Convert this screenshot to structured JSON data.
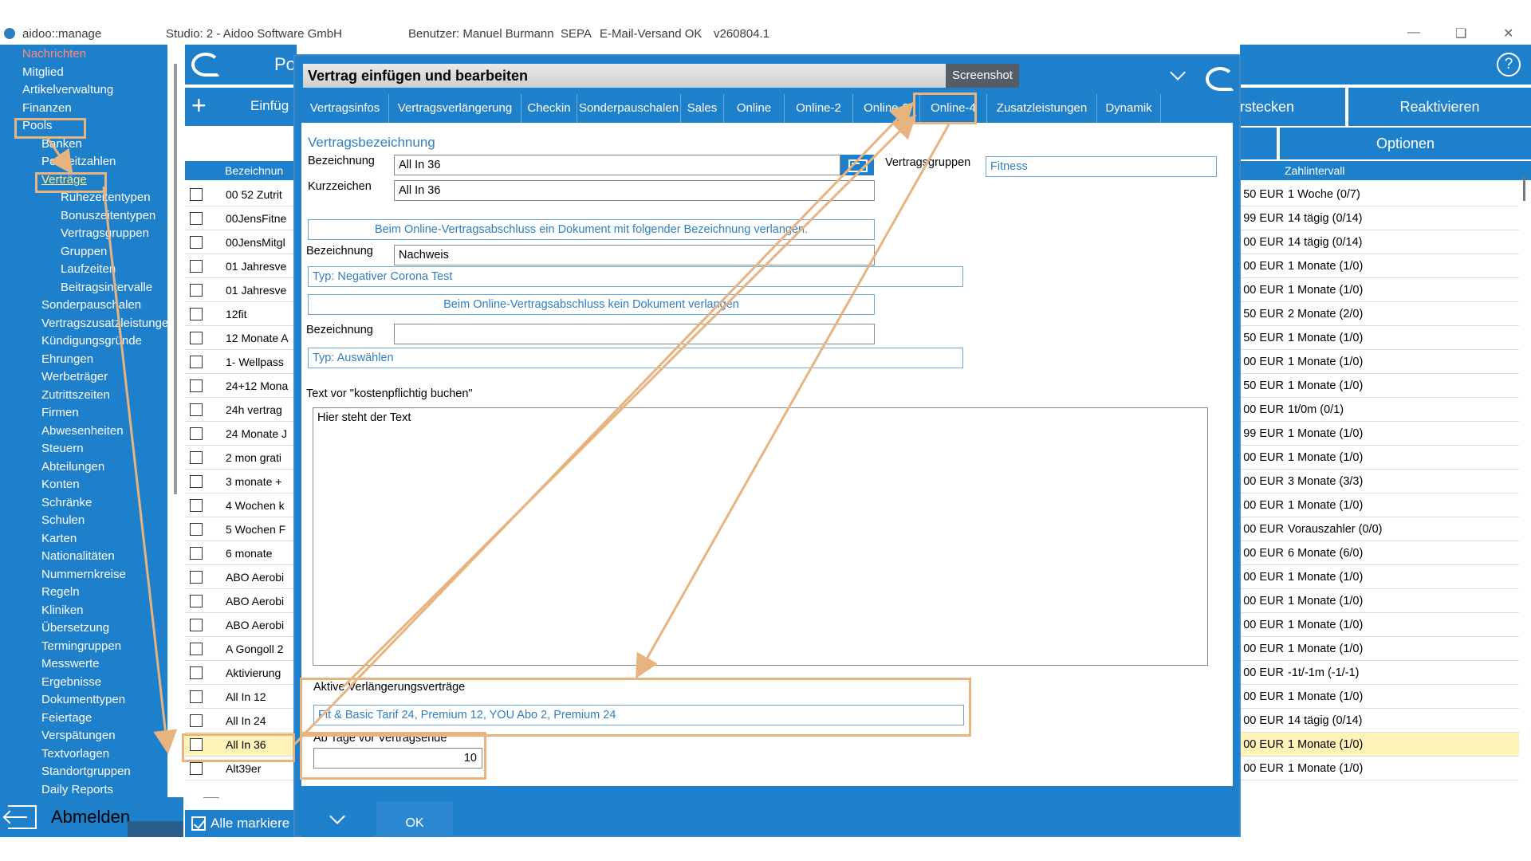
{
  "titlebar": {
    "app": "aidoo::manage",
    "studio": "Studio: 2 - Aidoo Software GmbH",
    "user": "Benutzer: Manuel Burmann",
    "sepa": "SEPA",
    "mail": "E-Mail-Versand OK",
    "version": "v260804.1"
  },
  "sidebar": {
    "items": [
      "Nachrichten",
      "Mitglied",
      "Artikelverwaltung",
      "Finanzen",
      "Pools",
      "Banken",
      "Postleitzahlen",
      "Verträge",
      "Ruhezeitentypen",
      "Bonuszeitentypen",
      "Vertragsgruppen",
      "Gruppen",
      "Laufzeiten",
      "Beitragsintervalle",
      "Sonderpauschalen",
      "Vertragszusatzleistungen",
      "Kündigungsgründe",
      "Ehrungen",
      "Werbeträger",
      "Zutrittszeiten",
      "Firmen",
      "Abwesenheiten",
      "Steuern",
      "Abteilungen",
      "Konten",
      "Schränke",
      "Schulen",
      "Karten",
      "Nationalitäten",
      "Nummernkreise",
      "Regeln",
      "Kliniken",
      "Übersetzung",
      "Termingruppen",
      "Messwerte",
      "Ergebnisse",
      "Dokumenttypen",
      "Feiertage",
      "Verspätungen",
      "Textvorlagen",
      "Standortgruppen",
      "Daily Reports"
    ],
    "logout": "Abmelden"
  },
  "background": {
    "top_label": "Po",
    "add_label": "Einfüg",
    "btn_einstecken": "rstecken",
    "btn_reactivate": "Reaktivieren",
    "btn_options": "Optionen",
    "list_header": "Bezeichnun",
    "right_header": "Zahlintervall",
    "mark_all": "Alle markiere",
    "rows": [
      {
        "name": "00 52 Zutrit",
        "amount": "50 EUR",
        "interval": "1 Woche (0/7)"
      },
      {
        "name": "00JensFitne",
        "amount": "99 EUR",
        "interval": "14 tägig (0/14)"
      },
      {
        "name": "00JensMitgl",
        "amount": "00 EUR",
        "interval": "14 tägig (0/14)"
      },
      {
        "name": "01 Jahresve",
        "amount": "00 EUR",
        "interval": "1 Monate (1/0)"
      },
      {
        "name": "01 Jahresve",
        "amount": "00 EUR",
        "interval": "1 Monate (1/0)"
      },
      {
        "name": "12fit",
        "amount": "50 EUR",
        "interval": "2 Monate (2/0)"
      },
      {
        "name": "12 Monate A",
        "amount": "50 EUR",
        "interval": "1 Monate (1/0)"
      },
      {
        "name": "1- Wellpass",
        "amount": "00 EUR",
        "interval": "1 Monate (1/0)"
      },
      {
        "name": "24+12 Mona",
        "amount": "50 EUR",
        "interval": "1 Monate (1/0)"
      },
      {
        "name": "24h vertrag",
        "amount": "00 EUR",
        "interval": "1t/0m (0/1)"
      },
      {
        "name": "24 Monate J",
        "amount": "99 EUR",
        "interval": "1 Monate (1/0)"
      },
      {
        "name": "2 mon grati",
        "amount": "00 EUR",
        "interval": "1 Monate (1/0)"
      },
      {
        "name": "3 monate +",
        "amount": "00 EUR",
        "interval": "3 Monate (3/3)"
      },
      {
        "name": "4 Wochen k",
        "amount": "00 EUR",
        "interval": "1 Monate (1/0)"
      },
      {
        "name": "5 Wochen F",
        "amount": "00 EUR",
        "interval": "Vorauszahler (0/0)"
      },
      {
        "name": "6 monate",
        "amount": "00 EUR",
        "interval": "6 Monate (6/0)"
      },
      {
        "name": "ABO Aerobi",
        "amount": "00 EUR",
        "interval": "1 Monate (1/0)"
      },
      {
        "name": "ABO Aerobi",
        "amount": "00 EUR",
        "interval": "1 Monate (1/0)"
      },
      {
        "name": "ABO Aerobi",
        "amount": "00 EUR",
        "interval": "1 Monate (1/0)"
      },
      {
        "name": "A Gongoll 2",
        "amount": "00 EUR",
        "interval": "1 Monate (1/0)"
      },
      {
        "name": "Aktivierung",
        "amount": "00 EUR",
        "interval": "-1t/-1m (-1/-1)"
      },
      {
        "name": "All In 12",
        "amount": "00 EUR",
        "interval": "1 Monate (1/0)"
      },
      {
        "name": "All In 24",
        "amount": "00 EUR",
        "interval": "14 tägig (0/14)"
      },
      {
        "name": "All In 36",
        "amount": "00 EUR",
        "interval": "1 Monate (1/0)"
      },
      {
        "name": "Alt39er",
        "amount": "00 EUR",
        "interval": "1 Monate (1/0)"
      }
    ]
  },
  "dialog": {
    "title": "Vertrag einfügen und bearbeiten",
    "screenshot_btn": "Screenshot",
    "tabs": [
      "Vertragsinfos",
      "Vertragsverlängerung",
      "Checkin",
      "Sonderpauschalen",
      "Sales",
      "Online",
      "Online-2",
      "Online-3",
      "Online-4",
      "Zusatzleistungen",
      "Dynamik"
    ],
    "section_title": "Vertragsbezeichnung",
    "lbl_bezeichnung": "Bezeichnung",
    "val_bezeichnung": "All In 36",
    "lbl_kurzzeichen": "Kurzzeichen",
    "val_kurzzeichen": "All In 36",
    "lbl_vertragsgruppen": "Vertragsgruppen",
    "val_vertragsgruppen": "Fitness",
    "btn_doc_require": "Beim Online-Vertragsabschluss ein Dokument mit folgender Bezeichnung verlangen.",
    "lbl_bez2": "Bezeichnung",
    "val_bez2": "Nachweis",
    "typ1": "Typ: Negativer Corona Test",
    "btn_no_doc": "Beim Online-Vertragsabschluss kein Dokument verlangen",
    "lbl_bez3": "Bezeichnung",
    "val_bez3": "",
    "typ2": "Typ: Auswählen",
    "lbl_text": "Text vor \"kostenpflichtig buchen\"",
    "text_value": "Hier steht der Text",
    "lbl_active": "Aktive Verlängerungsverträge",
    "val_active": "Fit & Basic Tarif 24, Premium 12, YOU Abo 2, Premium 24",
    "lbl_days": "Ab Tage vor Vertragsende",
    "val_days": "10",
    "ok": "OK"
  }
}
